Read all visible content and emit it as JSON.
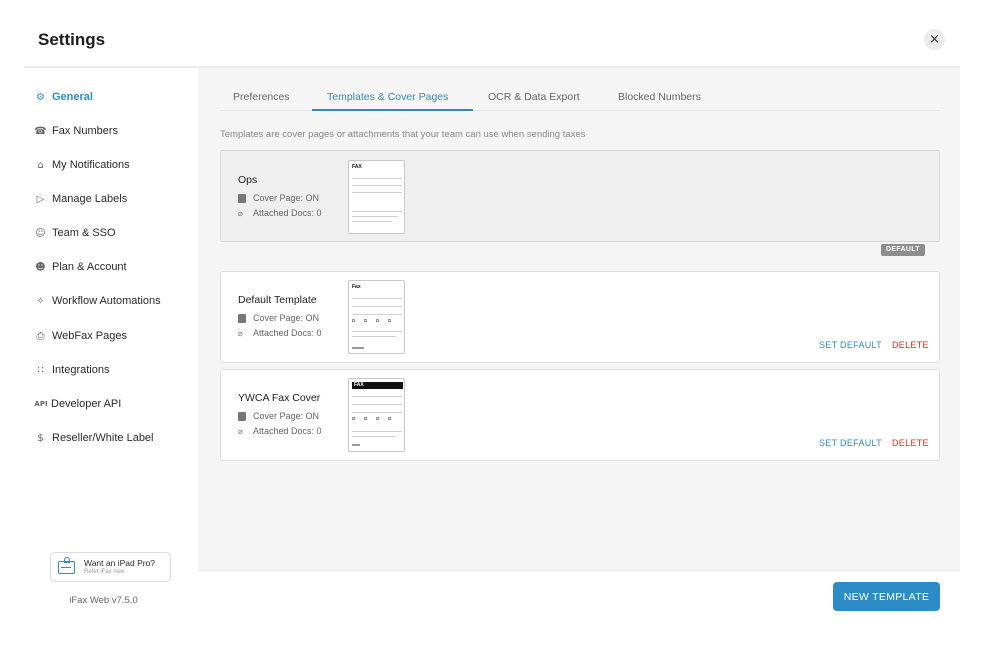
{
  "header": {
    "title": "Settings",
    "close_glyph": "×"
  },
  "sidebar": {
    "items": [
      {
        "label": "General",
        "icon": "gear-icon",
        "glyph": "⚙"
      },
      {
        "label": "Fax Numbers",
        "icon": "fax-icon",
        "glyph": "☎"
      },
      {
        "label": "My Notifications",
        "icon": "bell-icon",
        "glyph": "⌂"
      },
      {
        "label": "Manage Labels",
        "icon": "label-icon",
        "glyph": "▷"
      },
      {
        "label": "Team & SSO",
        "icon": "team-icon",
        "glyph": "☺"
      },
      {
        "label": "Plan & Account",
        "icon": "account-icon",
        "glyph": "☻"
      },
      {
        "label": "Workflow Automations",
        "icon": "sparkle-icon",
        "glyph": "✧"
      },
      {
        "label": "WebFax Pages",
        "icon": "printer-icon",
        "glyph": "⎙"
      },
      {
        "label": "Integrations",
        "icon": "grid-icon",
        "glyph": "∷"
      },
      {
        "label": "Developer API",
        "icon": "api-icon",
        "glyph": "API"
      },
      {
        "label": "Reseller/White Label",
        "icon": "dollar-icon",
        "glyph": "$"
      }
    ],
    "promo": {
      "title": "Want an iPad Pro?",
      "subtitle": "Refer iFax now"
    },
    "version": "iFax Web v7.5.0"
  },
  "tabs": [
    {
      "label": "Preferences",
      "active": false
    },
    {
      "label": "Templates & Cover Pages",
      "active": true
    },
    {
      "label": "OCR & Data Export",
      "active": false
    },
    {
      "label": "Blocked Numbers",
      "active": false
    }
  ],
  "intro": "Templates are cover pages or attachments that your team can use when sending taxes",
  "templates": [
    {
      "name": "Ops",
      "cover": "Cover Page: ON",
      "attached": "Attached Docs: 0",
      "thumb_header": "FAX",
      "badge": "DEFAULT"
    },
    {
      "name": "Default Template",
      "cover": "Cover Page: ON",
      "attached": "Attached Docs: 0",
      "thumb_header": "Fax",
      "set_default": "SET DEFAULT",
      "delete": "DELETE"
    },
    {
      "name": "YWCA Fax Cover",
      "cover": "Cover Page: ON",
      "attached": "Attached Docs: 0",
      "thumb_header": "FAX",
      "set_default": "SET DEFAULT",
      "delete": "DELETE"
    }
  ],
  "footer": {
    "new_template_label": "NEW TEMPLATE"
  },
  "colors": {
    "accent": "#2d8cc6",
    "danger": "#d93025",
    "badge": "#8d8d8d"
  }
}
